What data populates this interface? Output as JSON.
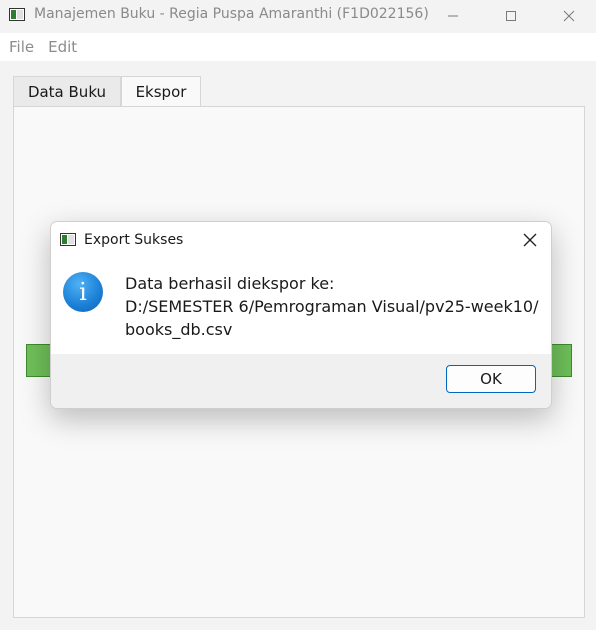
{
  "window": {
    "title": "Manajemen Buku - Regia Puspa Amaranthi (F1D022156)",
    "minimize_icon": "minimize-icon",
    "maximize_icon": "maximize-icon",
    "close_icon": "close-icon"
  },
  "menubar": {
    "items": [
      {
        "label": "File"
      },
      {
        "label": "Edit"
      }
    ]
  },
  "tabs": [
    {
      "label": "Data Buku",
      "active": false
    },
    {
      "label": "Ekspor",
      "active": true
    }
  ],
  "panel": {
    "button_color": "#6fbf5a"
  },
  "dialog": {
    "title": "Export Sukses",
    "icon": "info-icon",
    "message_lines": [
      "Data berhasil diekspor ke:",
      "D:/SEMESTER 6/Pemrograman Visual/pv25-week10/",
      "books_db.csv"
    ],
    "ok_label": "OK",
    "accent_color": "#0067c0"
  }
}
